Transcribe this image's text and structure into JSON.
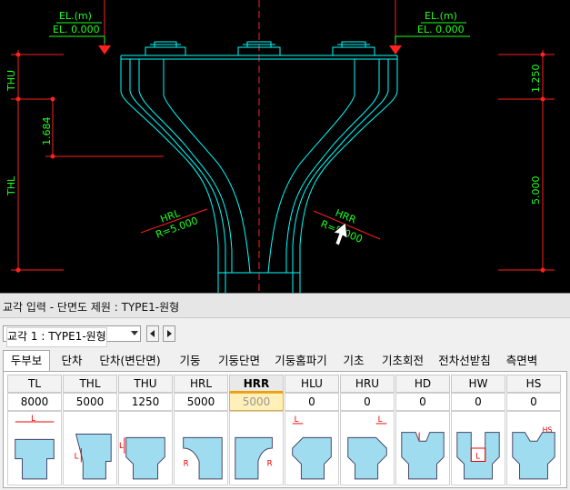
{
  "drawing": {
    "el_left": "EL.(m)",
    "el_left_value": "EL. 0.000",
    "el_right": "EL.(m)",
    "el_right_value": "EL. 0.000",
    "dim_thu": "THU",
    "dim_thl": "THL",
    "dim_1684": "1.684",
    "dim_1250": "1.250",
    "dim_5000": "5.000",
    "hrl_label": "HRL",
    "hrl_value": "R=5.000",
    "hrr_label": "HRR",
    "hrr_value": "R=5.000"
  },
  "window": {
    "title": "교각 입력 - 단면도 제원 : TYPE1-원형"
  },
  "selector": {
    "value": "교각 1 : TYPE1-원형"
  },
  "tabs": [
    {
      "label": "두부보"
    },
    {
      "label": "단차"
    },
    {
      "label": "단차(변단면)"
    },
    {
      "label": "기둥"
    },
    {
      "label": "기둥단면"
    },
    {
      "label": "기둥홈파기"
    },
    {
      "label": "기초"
    },
    {
      "label": "기초회전"
    },
    {
      "label": "전차선받침"
    },
    {
      "label": "측면벽"
    }
  ],
  "params": [
    {
      "name": "TL",
      "value": "8000",
      "icon": "cap-width-icon"
    },
    {
      "name": "THL",
      "value": "5000",
      "icon": "cap-lower-height-icon"
    },
    {
      "name": "THU",
      "value": "1250",
      "icon": "cap-upper-height-icon"
    },
    {
      "name": "HRL",
      "value": "5000",
      "icon": "left-radius-icon"
    },
    {
      "name": "HRR",
      "value": "5000",
      "icon": "right-radius-icon"
    },
    {
      "name": "HLU",
      "value": "0",
      "icon": "upper-left-chamfer-icon"
    },
    {
      "name": "HRU",
      "value": "0",
      "icon": "upper-right-chamfer-icon"
    },
    {
      "name": "HD",
      "value": "0",
      "icon": "groove-depth-icon"
    },
    {
      "name": "HW",
      "value": "0",
      "icon": "groove-width-icon"
    },
    {
      "name": "HS",
      "value": "0",
      "icon": "groove-slope-icon"
    }
  ],
  "selected_param": "HRR",
  "colors": {
    "cad_bg": "#000000",
    "cad_line": "#00ffff",
    "cad_dim": "#ff2020",
    "cad_text": "#20ff20",
    "highlight": "#ffefb8"
  }
}
